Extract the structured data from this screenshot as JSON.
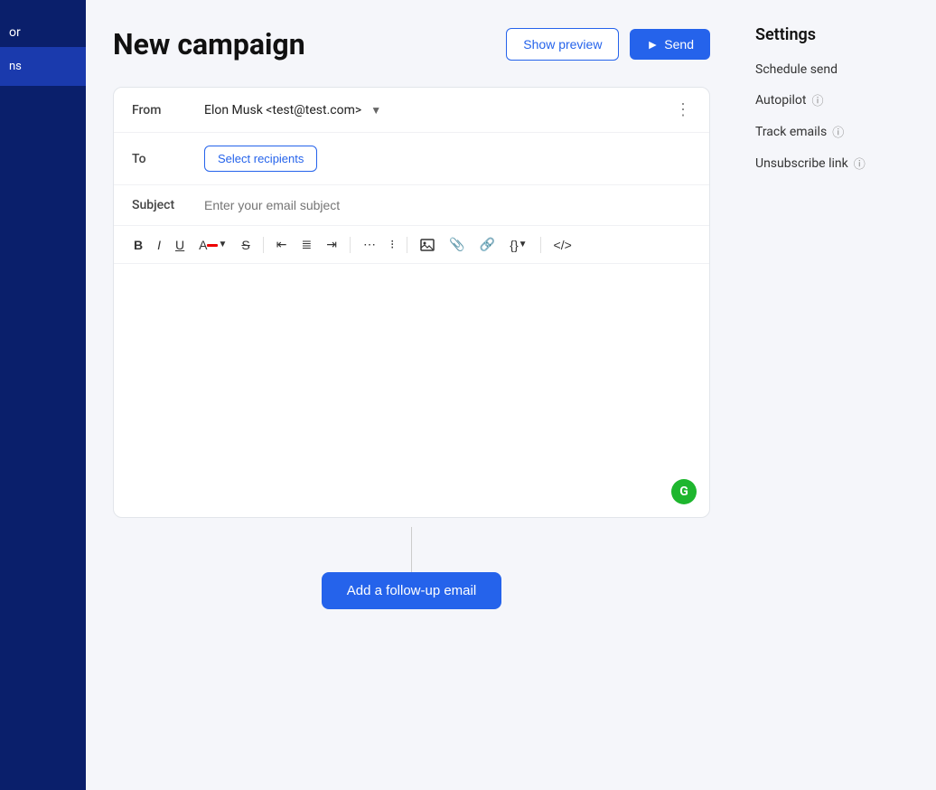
{
  "sidebar": {
    "or_label": "or",
    "active_item_label": "ns"
  },
  "header": {
    "page_title": "New campaign",
    "show_preview_label": "Show preview",
    "send_label": "Send"
  },
  "email_composer": {
    "from_label": "From",
    "from_value": "Elon Musk <test@test.com>",
    "to_label": "To",
    "select_recipients_label": "Select recipients",
    "subject_label": "Subject",
    "subject_placeholder": "Enter your email subject"
  },
  "toolbar": {
    "bold": "B",
    "italic": "I",
    "underline": "U",
    "strikethrough": "S"
  },
  "settings": {
    "title": "Settings",
    "schedule_send": "Schedule send",
    "autopilot": "Autopilot",
    "track_emails": "Track emails",
    "unsubscribe_link": "Unsubscribe link"
  },
  "followup": {
    "button_label": "Add a follow-up email"
  }
}
